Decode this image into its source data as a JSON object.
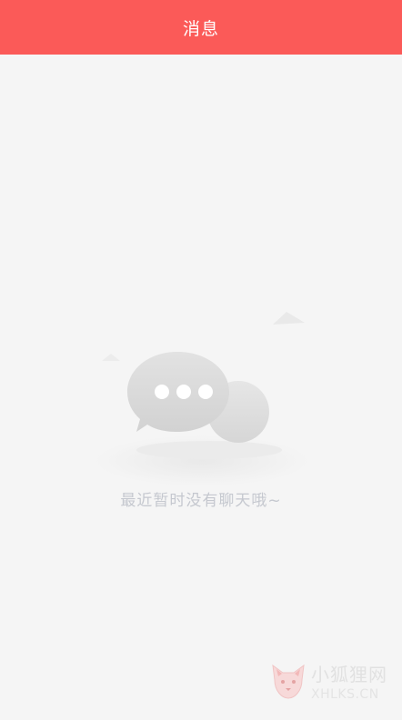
{
  "header": {
    "title": "消息"
  },
  "empty_state": {
    "message": "最近暂时没有聊天哦~",
    "illustration_icon": "chat-bubbles-icon"
  },
  "watermark": {
    "name": "小狐狸网",
    "domain": "XHLKS.CN",
    "logo_icon": "fox-logo-icon"
  },
  "colors": {
    "header_bg": "#fb5a58",
    "page_bg": "#f5f5f5",
    "empty_text": "#c5c8cf"
  }
}
